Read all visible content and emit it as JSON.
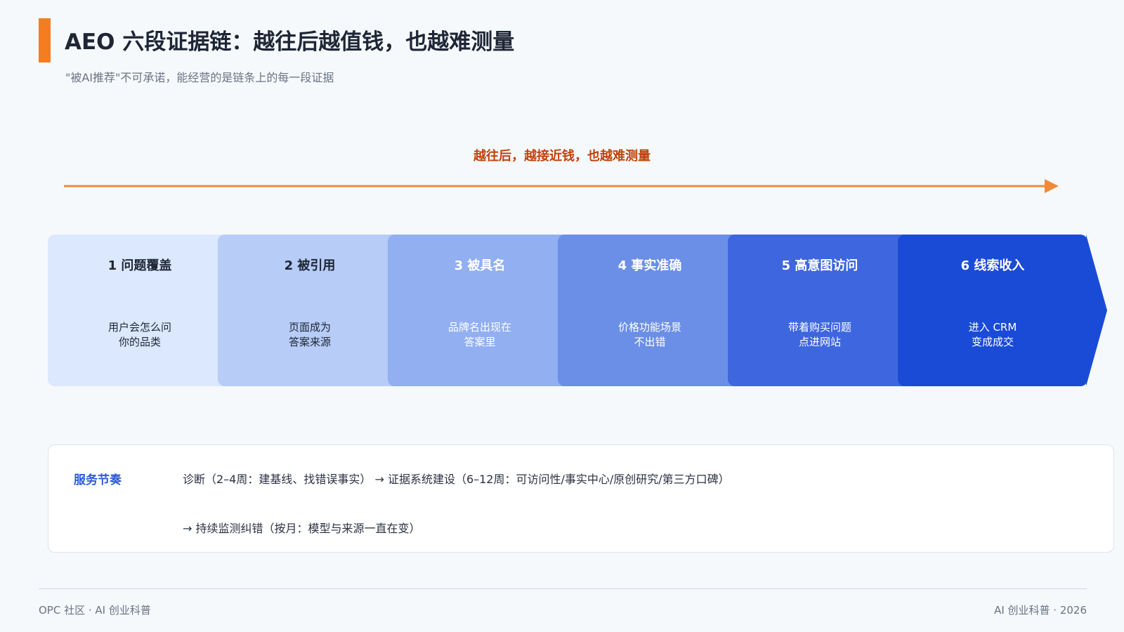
{
  "header": {
    "title": "AEO 六段证据链：越往后越值钱，也越难测量",
    "subtitle": "\"被AI推荐\"不可承诺，能经营的是链条上的每一段证据"
  },
  "flow": {
    "caption": "越往后，越接近钱，也越难测量",
    "arrow_color": "#ef8a3a",
    "stages": [
      {
        "title": "1 问题覆盖",
        "desc": [
          "用户会怎么问",
          "你的品类"
        ],
        "bg": "#dbe8fd",
        "fg": "#1e2636"
      },
      {
        "title": "2 被引用",
        "desc": [
          "页面成为",
          "答案来源"
        ],
        "bg": "#b7ccf6",
        "fg": "#1e2636"
      },
      {
        "title": "3 被具名",
        "desc": [
          "品牌名出现在",
          "答案里"
        ],
        "bg": "#91aff1",
        "fg": "#ffffff"
      },
      {
        "title": "4 事实准确",
        "desc": [
          "价格功能场景",
          "不出错"
        ],
        "bg": "#6b8fe6",
        "fg": "#ffffff"
      },
      {
        "title": "5 高意图访问",
        "desc": [
          "带着购买问题",
          "点进网站"
        ],
        "bg": "#3e66de",
        "fg": "#ffffff"
      },
      {
        "title": "6 线索收入",
        "desc": [
          "进入 CRM",
          "变成成交"
        ],
        "bg": "#1a4bd7",
        "fg": "#ffffff"
      }
    ]
  },
  "service": {
    "label": "服务节奏",
    "line1": "诊断（2–4周：建基线、找错误事实） → 证据系统建设（6–12周：可访问性/事实中心/原创研究/第三方口碑）",
    "line2": "→ 持续监测纠错（按月：模型与来源一直在变）"
  },
  "footer": {
    "left": "OPC 社区 · AI 创业科普",
    "right": "AI 创业科普 · 2026"
  }
}
